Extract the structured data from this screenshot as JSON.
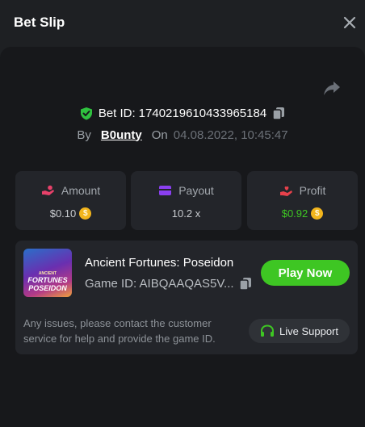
{
  "header": {
    "title": "Bet Slip",
    "close_icon": "close-icon"
  },
  "bet": {
    "id_label": "Bet ID:",
    "id_value": "1740219610433965184",
    "by_label": "By",
    "user": "B0unty",
    "on_label": "On",
    "date": "04.08.2022, 10:45:47"
  },
  "stats": {
    "amount": {
      "label": "Amount",
      "value": "$0.10",
      "icon": "hand-coins-icon",
      "icon_color": "#e8416a"
    },
    "payout": {
      "label": "Payout",
      "value": "10.2 x",
      "icon": "wallet-card-icon",
      "icon_color": "#8a3ff0"
    },
    "profit": {
      "label": "Profit",
      "value": "$0.92",
      "icon": "hand-heart-icon",
      "icon_color": "#e8414b",
      "value_color": "#3ec623"
    }
  },
  "game": {
    "title": "Ancient Fortunes: Poseidon",
    "id_text": "Game ID: AIBQAAQAS5V...",
    "thumb_small": "ANCIENT",
    "thumb_line1": "FORTUNES",
    "thumb_line2": "POSEIDON",
    "play_label": "Play Now",
    "issue_text": "Any issues, please contact the customer service for help and provide the game ID.",
    "support_label": "Live Support"
  },
  "colors": {
    "accent_green": "#3ec623",
    "shield_green": "#2fc23f",
    "coin": "#f2b51c"
  }
}
